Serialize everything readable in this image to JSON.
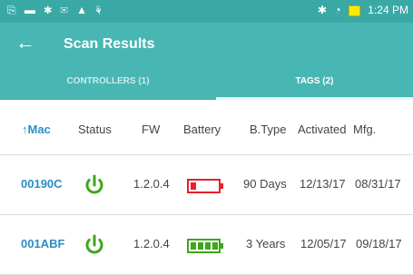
{
  "status_bar": {
    "left_icons": "⎘ ▬ ✱ ✉ ▲ ⚘",
    "bluetooth_icon": "✱",
    "wifi_icon": "◔",
    "time": "1:24 PM"
  },
  "app_bar": {
    "back_arrow": "←",
    "title": "Scan Results"
  },
  "tabs": {
    "controllers": "CONTROLLERS (1)",
    "tags": "TAGS (2)",
    "active": "tags"
  },
  "table": {
    "headers": {
      "mac": "↑Mac",
      "status": "Status",
      "fw": "FW",
      "battery": "Battery",
      "btype": "B.Type",
      "activated": "Activated",
      "mfg": "Mfg."
    },
    "rows": [
      {
        "mac": "00190C",
        "status_icon": "power-icon",
        "fw": "1.2.0.4",
        "battery_level": 0.2,
        "battery_color": "#e8202a",
        "btype": "90 Days",
        "activated": "12/13/17",
        "mfg": "08/31/17"
      },
      {
        "mac": "001ABF",
        "status_icon": "power-icon",
        "fw": "1.2.0.4",
        "battery_level": 1.0,
        "battery_color": "#3fa61b",
        "btype": "3 Years",
        "activated": "12/05/17",
        "mfg": "09/18/17"
      }
    ]
  },
  "colors": {
    "app_bar": "#48b6b3",
    "status_bar": "#3aa9a6",
    "mac_link": "#2c8ec5",
    "power_green": "#3fa61b"
  }
}
